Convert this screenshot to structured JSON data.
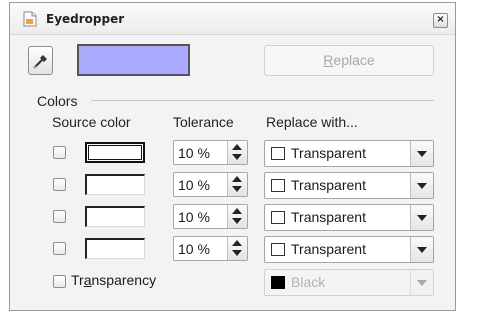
{
  "window": {
    "title": "Eyedropper",
    "close_glyph": "×"
  },
  "toolbar": {
    "dropper_icon": "pipette-icon",
    "preview_color": "#aaaaff",
    "replace_pre": "",
    "replace_u": "R",
    "replace_post": "eplace"
  },
  "colors": {
    "section_label": "Colors",
    "headers": {
      "source": "Source color",
      "tolerance": "Tolerance",
      "replace_with": "Replace with..."
    },
    "rows": [
      {
        "tolerance": "10 %",
        "replace": "Transparent"
      },
      {
        "tolerance": "10 %",
        "replace": "Transparent"
      },
      {
        "tolerance": "10 %",
        "replace": "Transparent"
      },
      {
        "tolerance": "10 %",
        "replace": "Transparent"
      }
    ]
  },
  "transparency": {
    "pre": "Tr",
    "u": "a",
    "post": "nsparency",
    "replace": "Black"
  }
}
